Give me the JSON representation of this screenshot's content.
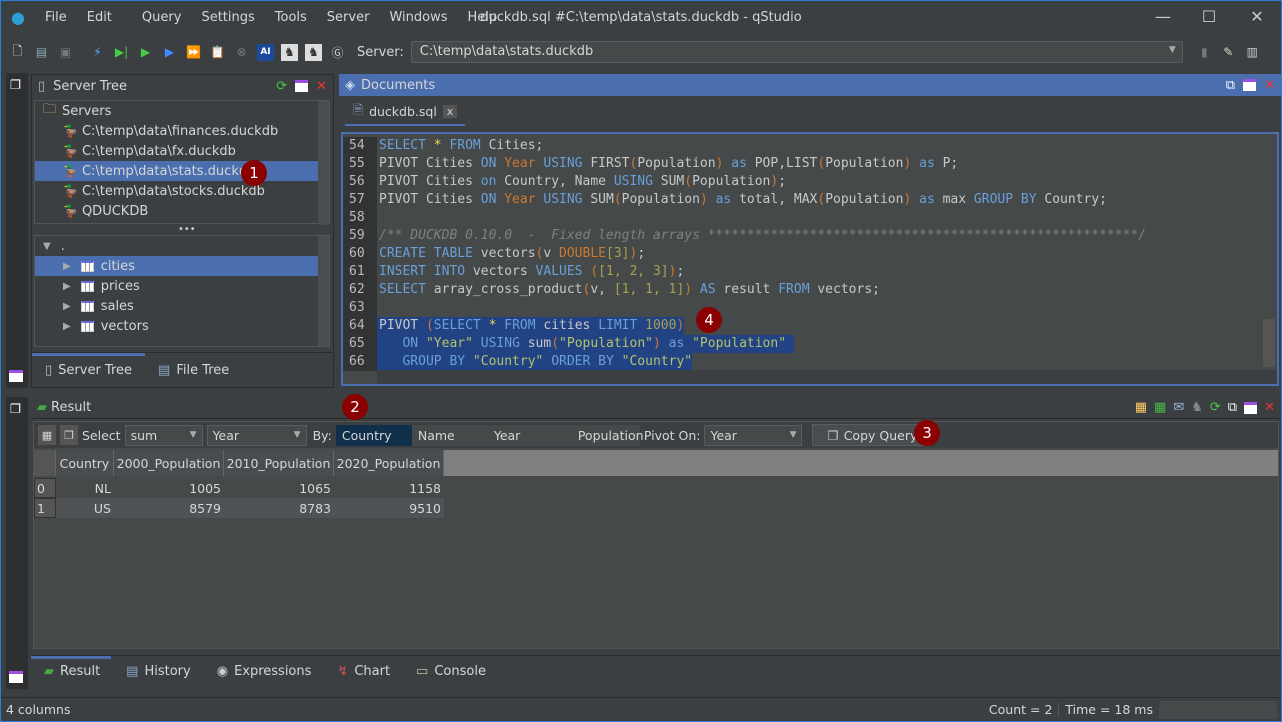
{
  "window": {
    "title": "duckdb.sql #C:\\temp\\data\\stats.duckdb - qStudio",
    "minimize": "—",
    "maximize": "☐",
    "close": "✕"
  },
  "menu": [
    "File",
    "Edit",
    "Query",
    "Settings",
    "Tools",
    "Server",
    "Windows",
    "Help"
  ],
  "toolbar": {
    "server_label": "Server:",
    "server_value": "C:\\temp\\data\\stats.duckdb"
  },
  "server_tree": {
    "title": "Server Tree",
    "root": "Servers",
    "servers": [
      "C:\\temp\\data\\finances.duckdb",
      "C:\\temp\\data\\fx.duckdb",
      "C:\\temp\\data\\stats.duckdb",
      "C:\\temp\\data\\stocks.duckdb",
      "QDUCKDB"
    ],
    "selected": 2,
    "schema_root": ".",
    "tables": [
      "cities",
      "prices",
      "sales",
      "vectors"
    ],
    "tabs": [
      "Server Tree",
      "File Tree"
    ]
  },
  "documents": {
    "title": "Documents",
    "tab": "duckdb.sql",
    "tab_close": "x",
    "lines": [
      {
        "n": "54",
        "t": [
          [
            "kw",
            "SELECT "
          ],
          [
            "st",
            "*"
          ],
          [
            "kw",
            " FROM "
          ],
          [
            "tx",
            "Cities;"
          ]
        ]
      },
      {
        "n": "55",
        "t": [
          [
            "tx",
            "PIVOT Cities "
          ],
          [
            "kw",
            "ON "
          ],
          [
            "or",
            "Year "
          ],
          [
            "kw",
            "USING "
          ],
          [
            "tx",
            "FIRST"
          ],
          [
            "or",
            "("
          ],
          [
            "tx",
            "Population"
          ],
          [
            "or",
            ")"
          ],
          [
            "kw",
            " as "
          ],
          [
            "tx",
            "POP,LIST"
          ],
          [
            "or",
            "("
          ],
          [
            "tx",
            "Population"
          ],
          [
            "or",
            ")"
          ],
          [
            "kw",
            " as "
          ],
          [
            "tx",
            "P;"
          ]
        ]
      },
      {
        "n": "56",
        "t": [
          [
            "tx",
            "PIVOT Cities "
          ],
          [
            "kw",
            "on "
          ],
          [
            "tx",
            "Country, Name "
          ],
          [
            "kw",
            "USING "
          ],
          [
            "tx",
            "SUM"
          ],
          [
            "or",
            "("
          ],
          [
            "tx",
            "Population"
          ],
          [
            "or",
            ")"
          ],
          [
            "tx",
            ";"
          ]
        ]
      },
      {
        "n": "57",
        "t": [
          [
            "tx",
            "PIVOT Cities "
          ],
          [
            "kw",
            "ON "
          ],
          [
            "or",
            "Year "
          ],
          [
            "kw",
            "USING "
          ],
          [
            "tx",
            "SUM"
          ],
          [
            "or",
            "("
          ],
          [
            "tx",
            "Population"
          ],
          [
            "or",
            ")"
          ],
          [
            "kw",
            " as "
          ],
          [
            "tx",
            "total, MAX"
          ],
          [
            "or",
            "("
          ],
          [
            "tx",
            "Population"
          ],
          [
            "or",
            ")"
          ],
          [
            "kw",
            " as "
          ],
          [
            "tx",
            "max "
          ],
          [
            "kw",
            "GROUP BY "
          ],
          [
            "tx",
            "Country;"
          ]
        ]
      },
      {
        "n": "58",
        "t": []
      },
      {
        "n": "59",
        "t": [
          [
            "cm",
            "/** DUCKDB 0.10.0  -  Fixed length arrays *******************************************************/"
          ]
        ]
      },
      {
        "n": "60",
        "t": [
          [
            "kw",
            "CREATE TABLE "
          ],
          [
            "tx",
            "vectors"
          ],
          [
            "or",
            "("
          ],
          [
            "tx",
            "v "
          ],
          [
            "or",
            "DOUBLE"
          ],
          [
            "num",
            "[3]"
          ],
          [
            "or",
            ")"
          ],
          [
            "tx",
            ";"
          ]
        ]
      },
      {
        "n": "61",
        "t": [
          [
            "kw",
            "INSERT INTO "
          ],
          [
            "tx",
            "vectors "
          ],
          [
            "kw",
            "VALUES "
          ],
          [
            "or",
            "("
          ],
          [
            "num",
            "[1, 2, 3]"
          ],
          [
            "or",
            ")"
          ],
          [
            "tx",
            ";"
          ]
        ]
      },
      {
        "n": "62",
        "t": [
          [
            "kw",
            "SELECT "
          ],
          [
            "tx",
            "array_cross_product"
          ],
          [
            "or",
            "("
          ],
          [
            "tx",
            "v, "
          ],
          [
            "num",
            "[1, 1, 1]"
          ],
          [
            "or",
            ")"
          ],
          [
            "kw",
            " AS "
          ],
          [
            "tx",
            "result "
          ],
          [
            "kw",
            "FROM "
          ],
          [
            "tx",
            "vectors;"
          ]
        ]
      },
      {
        "n": "63",
        "t": []
      },
      {
        "n": "64",
        "t": [
          [
            "tx",
            "PIVOT "
          ],
          [
            "or",
            "("
          ],
          [
            "kw",
            "SELECT "
          ],
          [
            "st",
            "*"
          ],
          [
            "kw",
            " FROM "
          ],
          [
            "tx",
            "cities "
          ],
          [
            "kw",
            "LIMIT "
          ],
          [
            "num",
            "1000"
          ],
          [
            "or",
            ")"
          ]
        ],
        "sel": true
      },
      {
        "n": "65",
        "t": [
          [
            "kw",
            "   ON "
          ],
          [
            "str",
            "\"Year\""
          ],
          [
            "kw",
            " USING "
          ],
          [
            "tx",
            "sum"
          ],
          [
            "or",
            "("
          ],
          [
            "str",
            "\"Population\""
          ],
          [
            "or",
            ")"
          ],
          [
            "kw",
            " as "
          ],
          [
            "str",
            "\"Population\" "
          ]
        ],
        "sel": true
      },
      {
        "n": "66",
        "t": [
          [
            "kw",
            "   GROUP BY "
          ],
          [
            "str",
            "\"Country\""
          ],
          [
            "kw",
            " ORDER BY "
          ],
          [
            "str",
            "\"Country\""
          ]
        ],
        "sel": true
      }
    ]
  },
  "result": {
    "title": "Result",
    "select_label": "Select",
    "agg": "sum",
    "agg_col": "Year",
    "by_label": "By:",
    "by_cols": [
      "Country",
      "Name",
      "Year",
      "Population"
    ],
    "pivot_label": "Pivot On:",
    "pivot_value": "Year",
    "copy_query": "Copy Query",
    "columns": [
      "Country",
      "2000_Population",
      "2010_Population",
      "2020_Population"
    ],
    "rows": [
      [
        "0",
        "NL",
        "1005",
        "1065",
        "1158"
      ],
      [
        "1",
        "US",
        "8579",
        "8783",
        "9510"
      ]
    ],
    "tabs": [
      "Result",
      "History",
      "Expressions",
      "Chart",
      "Console"
    ]
  },
  "badges": [
    "1",
    "2",
    "3",
    "4"
  ],
  "status": {
    "columns": "4 columns",
    "count": "Count = 2",
    "time": "Time = 18 ms"
  }
}
